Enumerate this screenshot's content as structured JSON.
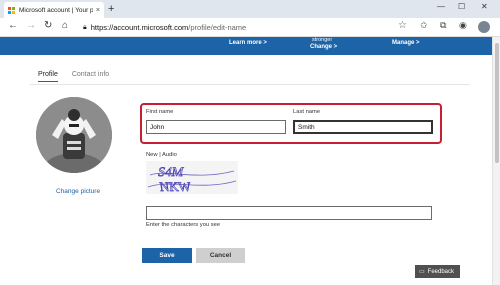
{
  "browser": {
    "tab_title": "Microsoft account | Your profile",
    "tab_close": "×",
    "new_tab": "+",
    "url_host": "https://account.microsoft.com",
    "url_path": "/profile/edit-name",
    "window_minimize": "—",
    "window_maximize": "☐",
    "window_close": "✕"
  },
  "banner": {
    "learn_more": "Learn more >",
    "stronger": "stronger",
    "change": "Change >",
    "manage": "Manage >"
  },
  "profile_tabs": [
    {
      "label": "Profile"
    },
    {
      "label": "Contact info"
    }
  ],
  "change_picture": "Change picture",
  "form": {
    "first_name_label": "First name",
    "first_name_value": "John",
    "last_name_label": "Last name",
    "last_name_value": "Smith",
    "captcha_mode": "New | Audio",
    "captcha_text": "S4M NKW",
    "captcha_hint": "Enter the characters you see",
    "captcha_value": ""
  },
  "buttons": {
    "save": "Save",
    "cancel": "Cancel"
  },
  "feedback": "Feedback",
  "colors": {
    "accent": "#1c63a7",
    "highlight": "#c41f32"
  }
}
